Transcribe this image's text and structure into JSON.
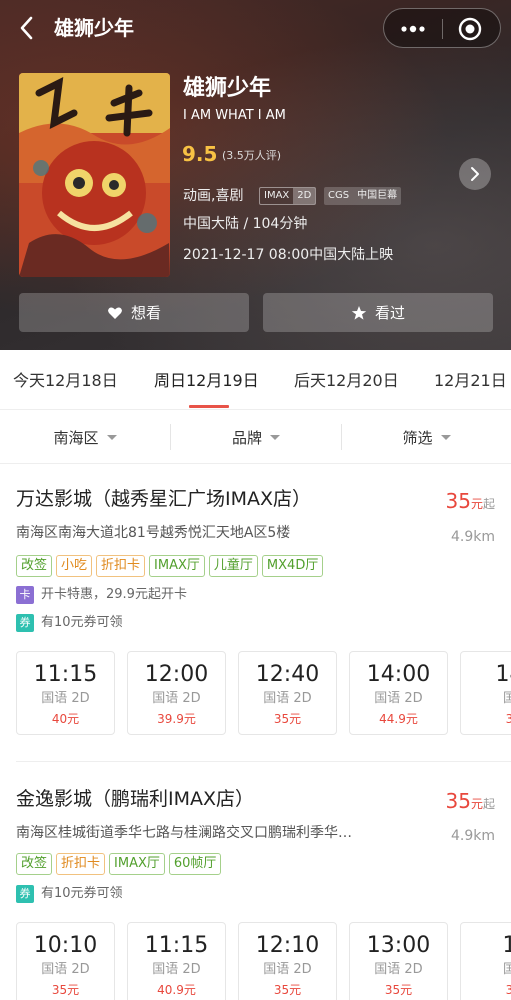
{
  "header": {
    "title": "雄狮少年"
  },
  "movie": {
    "title": "雄狮少年",
    "title_en": "I AM WHAT I AM",
    "score": "9.5",
    "score_count": "(3.5万人评)",
    "genre": "动画,喜剧",
    "tag_imax": [
      "IMAX",
      "2D"
    ],
    "tag_cgs": [
      "CGS",
      "中国巨幕"
    ],
    "region_duration": "中国大陆 / 104分钟",
    "release": "2021-12-17 08:00中国大陆上映",
    "want_label": "想看",
    "seen_label": "看过"
  },
  "date_tabs": [
    {
      "label": "今天12月18日"
    },
    {
      "label": "周日12月19日",
      "active": true
    },
    {
      "label": "后天12月20日"
    },
    {
      "label": "12月21日"
    }
  ],
  "filters": [
    {
      "label": "南海区"
    },
    {
      "label": "品牌"
    },
    {
      "label": "筛选"
    }
  ],
  "cinemas": [
    {
      "name": "万达影城（越秀星汇广场IMAX店）",
      "price": "35",
      "price_unit": "元",
      "price_suffix": "起",
      "address": "南海区南海大道北81号越秀悦汇天地A区5楼",
      "distance": "4.9km",
      "features": [
        {
          "label": "改签",
          "color": "green"
        },
        {
          "label": "小吃",
          "color": "orange"
        },
        {
          "label": "折扣卡",
          "color": "orange"
        },
        {
          "label": "IMAX厅",
          "color": "green"
        },
        {
          "label": "儿童厅",
          "color": "green"
        },
        {
          "label": "MX4D厅",
          "color": "green"
        }
      ],
      "card_badge": "卡",
      "card_text": "开卡特惠，29.9元起开卡",
      "coupon_badge": "券",
      "coupon_text": "有10元券可领",
      "shows": [
        {
          "time": "11:15",
          "lang": "国语 2D",
          "price": "40元"
        },
        {
          "time": "12:00",
          "lang": "国语 2D",
          "price": "39.9元"
        },
        {
          "time": "12:40",
          "lang": "国语 2D",
          "price": "35元"
        },
        {
          "time": "14:00",
          "lang": "国语 2D",
          "price": "44.9元"
        },
        {
          "time": "14",
          "lang": "国",
          "price": "3"
        }
      ]
    },
    {
      "name": "金逸影城（鹏瑞利IMAX店）",
      "price": "35",
      "price_unit": "元",
      "price_suffix": "起",
      "address": "南海区桂城街道季华七路与桂澜路交叉口鹏瑞利季华…",
      "distance": "4.9km",
      "features": [
        {
          "label": "改签",
          "color": "green"
        },
        {
          "label": "折扣卡",
          "color": "orange"
        },
        {
          "label": "IMAX厅",
          "color": "green"
        },
        {
          "label": "60帧厅",
          "color": "green"
        }
      ],
      "coupon_badge": "券",
      "coupon_text": "有10元券可领",
      "shows": [
        {
          "time": "10:10",
          "lang": "国语 2D",
          "price": "35元"
        },
        {
          "time": "11:15",
          "lang": "国语 2D",
          "price": "40.9元"
        },
        {
          "time": "12:10",
          "lang": "国语 2D",
          "price": "35元"
        },
        {
          "time": "13:00",
          "lang": "国语 2D",
          "price": "35元"
        },
        {
          "time": "1",
          "lang": "国",
          "price": "3"
        }
      ]
    }
  ],
  "colors": {
    "accent_red": "#e8483d",
    "score_yellow": "#f8c244",
    "tag_green": "#53a02e",
    "tag_orange": "#e08a1e"
  },
  "icons": {
    "back": "chevron-left-icon",
    "more": "more-dots-icon",
    "close": "target-close-icon",
    "detail": "chevron-right-icon",
    "want": "heart-icon",
    "seen": "star-icon"
  }
}
